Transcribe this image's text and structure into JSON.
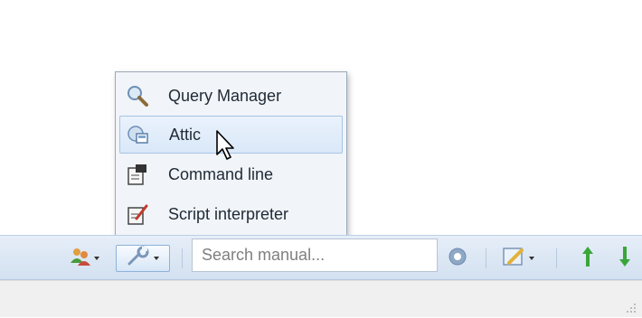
{
  "menu": {
    "items": [
      {
        "label": "Query Manager",
        "icon": "magnifier-icon"
      },
      {
        "label": "Attic",
        "icon": "attic-icon"
      },
      {
        "label": "Command line",
        "icon": "command-line-icon"
      },
      {
        "label": "Script interpreter",
        "icon": "script-icon"
      }
    ],
    "hovered_index": 1
  },
  "toolbar": {
    "search_placeholder": "Search manual...",
    "icons": [
      "users-icon",
      "tools-wrench-icon",
      "help-icon",
      "edit-notes-icon",
      "arrow-up-icon",
      "arrow-down-icon"
    ]
  },
  "colors": {
    "toolbar_top": "#e6eef8",
    "toolbar_bottom": "#d3e1f1",
    "menu_bg": "#f1f4f8",
    "hover_border": "#a7c4e6",
    "arrow_green": "#3aa63a"
  }
}
